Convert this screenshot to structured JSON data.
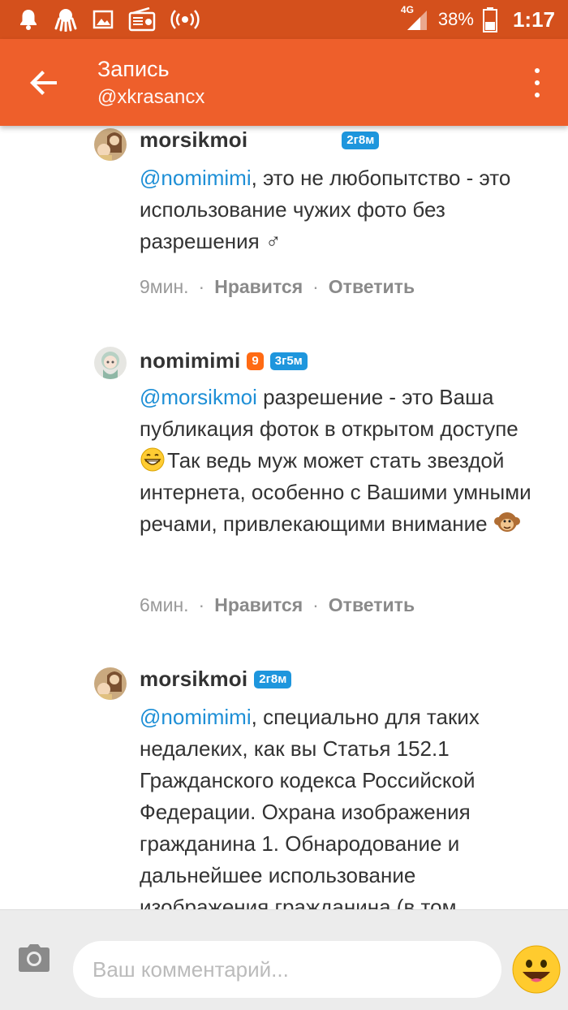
{
  "status_bar": {
    "network": "4G",
    "battery": "38%",
    "time": "1:17"
  },
  "header": {
    "title": "Запись",
    "subtitle": "@xkrasancx"
  },
  "comments": [
    {
      "author": "morsikmoi",
      "badges": [
        "2г8м"
      ],
      "mention": "@nomimimi",
      "text": ", это не любопытство - это использование чужих фото без разрешения ♂",
      "time": "9мин.",
      "like": "Нравится",
      "reply": "Ответить"
    },
    {
      "author": "nomimimi",
      "level": "9",
      "badges": [
        "3г5м"
      ],
      "mention": "@morsikmoi",
      "text_part1": " разрешение - это Ваша публикация фоток в открытом доступе ",
      "text_part2": "Так ведь муж может стать звездой интернета, особенно с Вашими умными речами, привлекающими внимание ",
      "time": "6мин.",
      "like": "Нравится",
      "reply": "Ответить"
    },
    {
      "author": "morsikmoi",
      "badges": [
        "2г8м"
      ],
      "mention": "@nomimimi",
      "text": ", специально для таких недалеких, как вы Статья 152.1 Гражданского кодекса Российской Федерации. Охрана изображения гражданина 1. Обнародование и дальнейшее использование изображения гражданина (в том"
    }
  ],
  "composer": {
    "placeholder": "Ваш комментарий..."
  },
  "colors": {
    "status_bar": "#d4501c",
    "app_bar": "#ee5f2b",
    "mention": "#1e8fd6",
    "badge_blue": "#1e96dd",
    "badge_orange": "#ff6a13"
  }
}
